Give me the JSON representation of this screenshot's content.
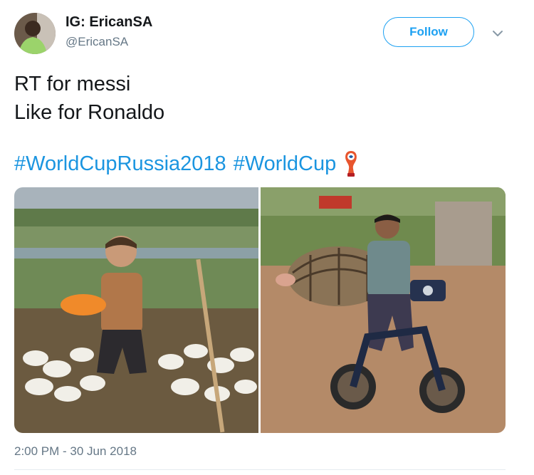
{
  "tweet": {
    "author": {
      "display_name": "IG: EricanSA",
      "handle": "@EricanSA",
      "avatar_icon": "avatar-photo"
    },
    "follow_label": "Follow",
    "menu_icon": "chevron-down-icon",
    "text_lines": [
      "RT for messi",
      "Like for Ronaldo"
    ],
    "hashtags": [
      "#WorldCupRussia2018",
      "#WorldCup"
    ],
    "emoji_icon": "world-cup-trophy-icon",
    "media": [
      {
        "kind": "photo",
        "subject": "man holding orange basin among ducks"
      },
      {
        "kind": "photo",
        "subject": "man riding motorbike carrying pig in basket"
      }
    ],
    "timestamp": "2:00 PM - 30 Jun 2018"
  },
  "colors": {
    "accent": "#1da1f2",
    "hashtag": "#1b95e0",
    "secondary_text": "#657786",
    "primary_text": "#14171a"
  }
}
